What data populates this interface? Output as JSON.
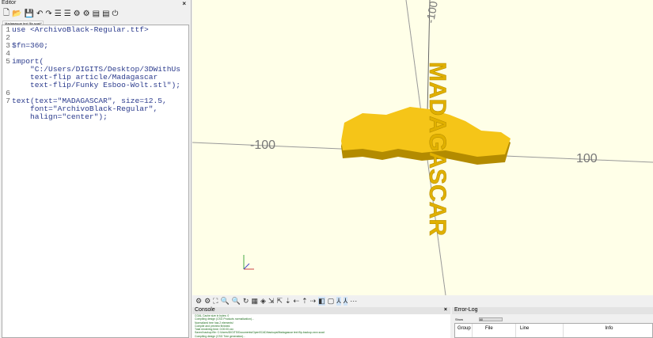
{
  "editor": {
    "title": "Editor",
    "tab": "Madagascar text flip.scad*",
    "lines": [
      {
        "n": "1",
        "t": "use <ArchivoBlack-Regular.ttf>"
      },
      {
        "n": "2",
        "t": ""
      },
      {
        "n": "3",
        "t": "$fn=360;"
      },
      {
        "n": "4",
        "t": ""
      },
      {
        "n": "5",
        "t": "import("
      },
      {
        "n": "",
        "t": "    \"C:/Users/DIGITS/Desktop/3DWithUs"
      },
      {
        "n": "",
        "t": "    text-flip article/Madagascar"
      },
      {
        "n": "",
        "t": "    text-flip/Funky Esboo-Wolt.stl\");"
      },
      {
        "n": "6",
        "t": ""
      },
      {
        "n": "7",
        "t": "text(text=\"MADAGASCAR\", size=12.5,"
      },
      {
        "n": "",
        "t": "    font=\"ArchivoBlack-Regular\","
      },
      {
        "n": "",
        "t": "    halign=\"center\");"
      }
    ]
  },
  "viewport": {
    "axis_labels": [
      "-100",
      "100",
      "-100"
    ],
    "model_text": "MADAGASCAR",
    "model_color": "#f5c518",
    "bg": "#ffffe8"
  },
  "console": {
    "title": "Console",
    "lines": [
      "CGAL Cache size in bytes: 0",
      "Compiling design (CSG Products normalization)...",
      "Normalized tree has 2 elements!",
      "Compile and preview finished.",
      "Total rendering time: 0:00:00.xxx",
      "Saved backup file: C:/Users/DIGITS/Documents/OpenSCAD/backups/Madagascar text flip-backup-xxxx.scad",
      "Compiling design (CSG Tree generation)..."
    ]
  },
  "errorlog": {
    "title": "Error-Log",
    "show_label": "Show",
    "show_value": "All",
    "columns": [
      "Group",
      "File",
      "Line",
      "Info"
    ]
  }
}
